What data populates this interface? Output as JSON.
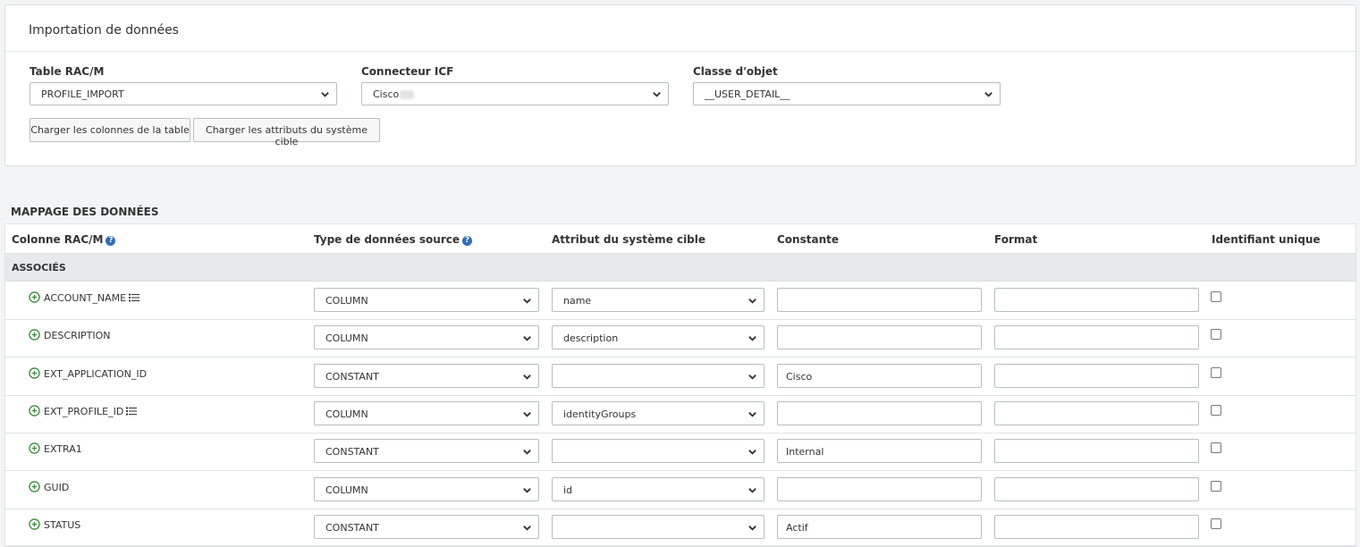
{
  "panel": {
    "title": "Importation de données",
    "table_label": "Table RAC/M",
    "table_value": "PROFILE_IMPORT",
    "connector_label": "Connecteur ICF",
    "connector_value": "Cisco",
    "class_label": "Classe d'objet",
    "class_value": "__USER_DETAIL__",
    "load_columns_button": "Charger les colonnes de la table",
    "load_attributes_button": "Charger les attributs du système cible"
  },
  "mapping": {
    "section_title": "MAPPAGE DES DONNÉES",
    "headers": {
      "column": "Colonne RAC/M",
      "source_type": "Type de données source",
      "target_attribute": "Attribut du système cible",
      "constant": "Constante",
      "format": "Format",
      "unique_id": "Identifiant unique"
    },
    "group_label": "ASSOCIÉS",
    "rows": [
      {
        "column": "ACCOUNT_NAME",
        "has_list": true,
        "source_type": "COLUMN",
        "target_attribute": "name",
        "constant": "",
        "format": "",
        "unique": false
      },
      {
        "column": "DESCRIPTION",
        "has_list": false,
        "source_type": "COLUMN",
        "target_attribute": "description",
        "constant": "",
        "format": "",
        "unique": false
      },
      {
        "column": "EXT_APPLICATION_ID",
        "has_list": false,
        "source_type": "CONSTANT",
        "target_attribute": "",
        "constant": "Cisco",
        "format": "",
        "unique": false
      },
      {
        "column": "EXT_PROFILE_ID",
        "has_list": true,
        "source_type": "COLUMN",
        "target_attribute": "identityGroups",
        "constant": "",
        "format": "",
        "unique": false
      },
      {
        "column": "EXTRA1",
        "has_list": false,
        "source_type": "CONSTANT",
        "target_attribute": "",
        "constant": "Internal",
        "format": "",
        "unique": false
      },
      {
        "column": "GUID",
        "has_list": false,
        "source_type": "COLUMN",
        "target_attribute": "id",
        "constant": "",
        "format": "",
        "unique": false
      },
      {
        "column": "STATUS",
        "has_list": false,
        "source_type": "CONSTANT",
        "target_attribute": "",
        "constant": "Actif",
        "format": "",
        "unique": false
      }
    ]
  },
  "icons": {
    "dropdown": "chevron-down-icon",
    "add": "plus-circle-icon",
    "list": "list-icon",
    "help": "help-circle-icon"
  },
  "colors": {
    "add_icon": "#3a8a3a",
    "help_icon": "#2f6fb5",
    "group_background": "#e8e9ea"
  }
}
